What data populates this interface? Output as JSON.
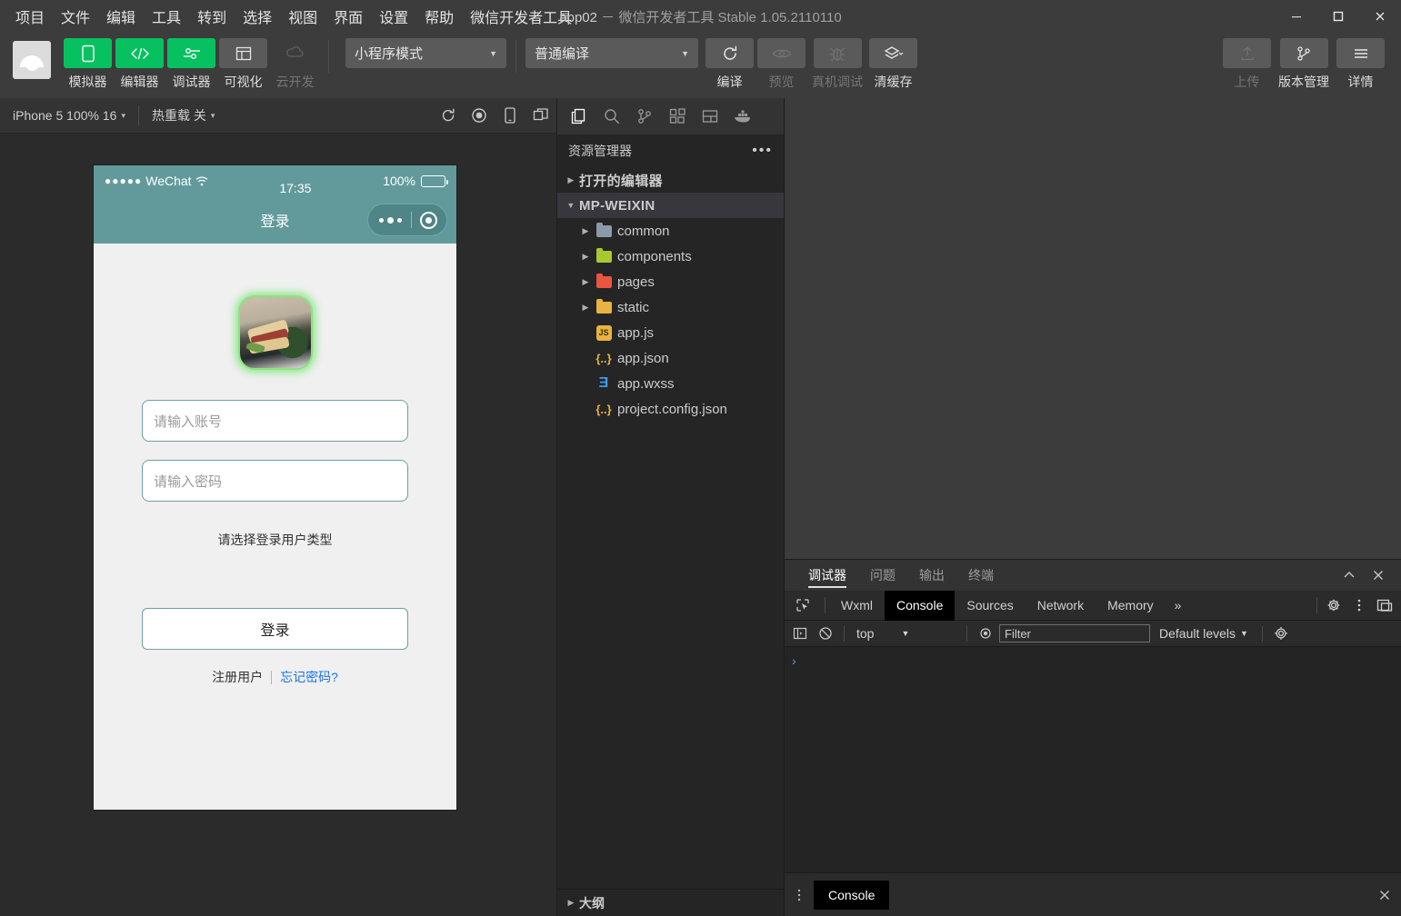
{
  "window": {
    "title_app": "app02",
    "title_rest": "－ 微信开发者工具 Stable 1.05.2110110",
    "minimize": "－",
    "maximize": "□",
    "close": "✕"
  },
  "menubar": {
    "items": [
      {
        "label": "项目"
      },
      {
        "label": "文件"
      },
      {
        "label": "编辑"
      },
      {
        "label": "工具"
      },
      {
        "label": "转到"
      },
      {
        "label": "选择"
      },
      {
        "label": "视图"
      },
      {
        "label": "界面"
      },
      {
        "label": "设置"
      },
      {
        "label": "帮助"
      },
      {
        "label": "微信开发者工具"
      }
    ]
  },
  "toolbar": {
    "buttons": [
      {
        "label": "模拟器",
        "icon": "phone-icon",
        "state": "active"
      },
      {
        "label": "编辑器",
        "icon": "code-icon",
        "state": "active"
      },
      {
        "label": "调试器",
        "icon": "debug-icon",
        "state": "active"
      },
      {
        "label": "可视化",
        "icon": "layout-icon",
        "state": "normal"
      },
      {
        "label": "云开发",
        "icon": "cloud-icon",
        "state": "disabled"
      }
    ],
    "mode_select": "小程序模式",
    "compile_select": "普通编译",
    "actions": [
      {
        "label": "编译",
        "icon": "refresh-icon",
        "state": "normal"
      },
      {
        "label": "预览",
        "icon": "eye-icon",
        "state": "disabled"
      },
      {
        "label": "真机调试",
        "icon": "bug-icon",
        "state": "disabled"
      },
      {
        "label": "清缓存",
        "icon": "layers-icon",
        "state": "normal"
      }
    ],
    "right_actions": [
      {
        "label": "上传",
        "icon": "upload-icon",
        "state": "disabled"
      },
      {
        "label": "版本管理",
        "icon": "branch-icon",
        "state": "normal"
      },
      {
        "label": "详情",
        "icon": "menu-icon",
        "state": "normal"
      }
    ],
    "caret": "▼"
  },
  "simulator": {
    "device": "iPhone 5 100% 16",
    "hot_reload": "热重载 关",
    "caret": "▾",
    "icons": [
      "refresh-icon",
      "record-icon",
      "device-icon",
      "detach-window-icon"
    ],
    "phone": {
      "status": {
        "carrier": "WeChat",
        "dots": "●●●●●",
        "time": "17:35",
        "battery_pct": "100%"
      },
      "nav_title": "登录",
      "fields": [
        {
          "placeholder": "请输入账号",
          "value": ""
        },
        {
          "placeholder": "请输入密码",
          "value": ""
        }
      ],
      "type_hint": "请选择登录用户类型",
      "login_button": "登录",
      "links": {
        "register": "注册用户",
        "forgot": "忘记密码?"
      }
    }
  },
  "explorer": {
    "activity_icons": [
      {
        "name": "files-icon",
        "active": true
      },
      {
        "name": "search-icon",
        "active": false
      },
      {
        "name": "source-control-icon",
        "active": false
      },
      {
        "name": "extensions-icon",
        "active": false
      },
      {
        "name": "layout-icon",
        "active": false
      },
      {
        "name": "docker-whale-icon",
        "active": false
      }
    ],
    "header": "资源管理器",
    "header_more": "•••",
    "sections": [
      {
        "label": "打开的编辑器",
        "expanded": false
      },
      {
        "label": "MP-WEIXIN",
        "expanded": true
      }
    ],
    "tree": [
      {
        "name": "common",
        "type": "folder",
        "color": "#8a9aa8",
        "expanded": false
      },
      {
        "name": "components",
        "type": "folder",
        "color": "#a8c832",
        "expanded": false
      },
      {
        "name": "pages",
        "type": "folder",
        "color": "#e8563f",
        "expanded": false
      },
      {
        "name": "static",
        "type": "folder",
        "color": "#e8b33f",
        "expanded": false
      },
      {
        "name": "app.js",
        "type": "file",
        "icon_label": "JS",
        "color": "#e8b33f"
      },
      {
        "name": "app.json",
        "type": "file",
        "icon_label": "{..}",
        "color": "#e8b33f"
      },
      {
        "name": "app.wxss",
        "type": "file",
        "icon_label": "Ǝ",
        "color": "#3e9bf0"
      },
      {
        "name": "project.config.json",
        "type": "file",
        "icon_label": "{..}",
        "color": "#e8b33f"
      }
    ],
    "outline": "大纲"
  },
  "devtools": {
    "panel_tabs": [
      {
        "label": "调试器",
        "active": true
      },
      {
        "label": "问题",
        "active": false
      },
      {
        "label": "输出",
        "active": false
      },
      {
        "label": "终端",
        "active": false
      }
    ],
    "panel_controls": [
      {
        "name": "collapse-icon",
        "glyph": "︿"
      },
      {
        "name": "close-icon",
        "glyph": "✕"
      }
    ],
    "cdt_tabs": [
      {
        "label": "Wxml",
        "active": false
      },
      {
        "label": "Console",
        "active": true
      },
      {
        "label": "Sources",
        "active": false
      },
      {
        "label": "Network",
        "active": false
      },
      {
        "label": "Memory",
        "active": false
      }
    ],
    "cdt_more": "»",
    "console": {
      "context": "top",
      "filter_placeholder": "Filter",
      "levels": "Default levels",
      "levels_caret": "▼",
      "prompt": "›"
    },
    "drawer": {
      "tab": "Console",
      "close": "✕"
    }
  }
}
